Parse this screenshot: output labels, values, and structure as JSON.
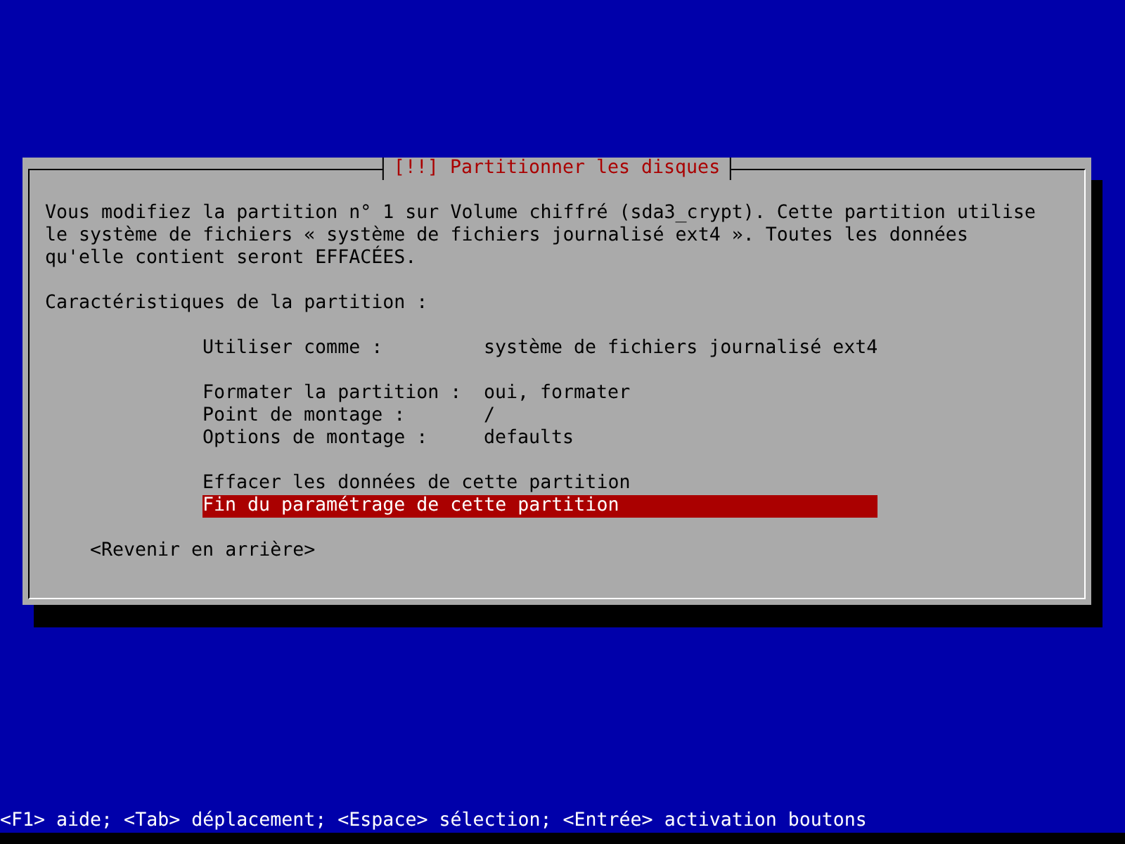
{
  "dialog": {
    "title": "[!!] Partitionner les disques",
    "message": "Vous modifiez la partition n° 1 sur Volume chiffré (sda3_crypt). Cette partition utilise\nle système de fichiers « système de fichiers journalisé ext4 ». Toutes les données\nqu'elle contient seront EFFACÉES.",
    "section_label": "Caractéristiques de la partition :",
    "groups": [
      [
        {
          "label": "Utiliser comme :",
          "value": "système de fichiers journalisé ext4",
          "selected": false
        }
      ],
      [
        {
          "label": "Formater la partition :",
          "value": "oui, formater",
          "selected": false
        },
        {
          "label": "Point de montage :",
          "value": "/",
          "selected": false
        },
        {
          "label": "Options de montage :",
          "value": "defaults",
          "selected": false
        }
      ],
      [
        {
          "label": "Effacer les données de cette partition",
          "selected": false
        },
        {
          "label": "Fin du paramétrage de cette partition",
          "selected": true
        }
      ]
    ],
    "back_button": "<Revenir en arrière>"
  },
  "status_bar": "<F1> aide; <Tab> déplacement; <Espace> sélection; <Entrée> activation boutons"
}
